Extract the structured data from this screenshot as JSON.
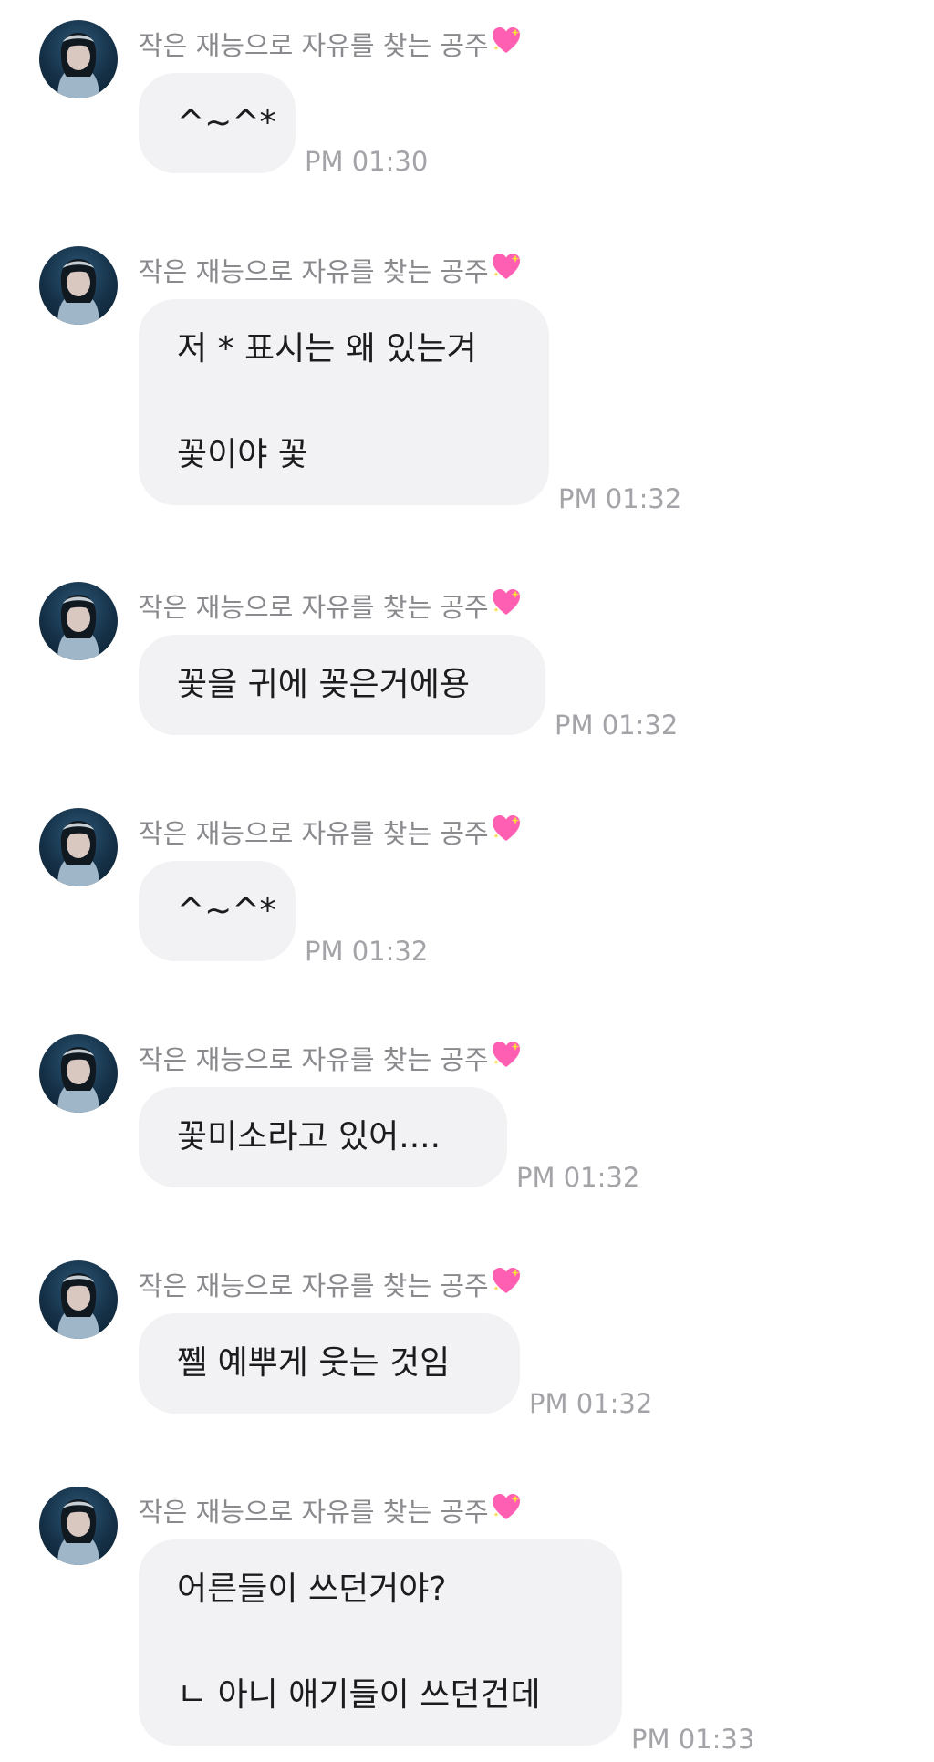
{
  "chat": {
    "sender_name": "작은 재능으로 자유를 찾는 공주",
    "sender_icon": "sparkling-heart-icon",
    "bubble_color": "#f2f2f4",
    "heart_color": "#ff5fb2",
    "messages": [
      {
        "lines": [
          "^~^*"
        ],
        "time": "PM 01:30"
      },
      {
        "lines": [
          "저 * 표시는 왜 있는겨",
          "",
          "꽃이야 꽃"
        ],
        "time": "PM 01:32"
      },
      {
        "lines": [
          "꽃을 귀에 꽂은거에용"
        ],
        "time": "PM 01:32"
      },
      {
        "lines": [
          "^~^*"
        ],
        "time": "PM 01:32"
      },
      {
        "lines": [
          "꽃미소라고 있어...."
        ],
        "time": "PM 01:32"
      },
      {
        "lines": [
          "쩰 예뿌게 웃는 것임"
        ],
        "time": "PM 01:32"
      },
      {
        "lines": [
          "어른들이 쓰던거야?",
          "",
          "ㄴ 아니 애기들이 쓰던건데"
        ],
        "time": "PM 01:33"
      }
    ]
  }
}
